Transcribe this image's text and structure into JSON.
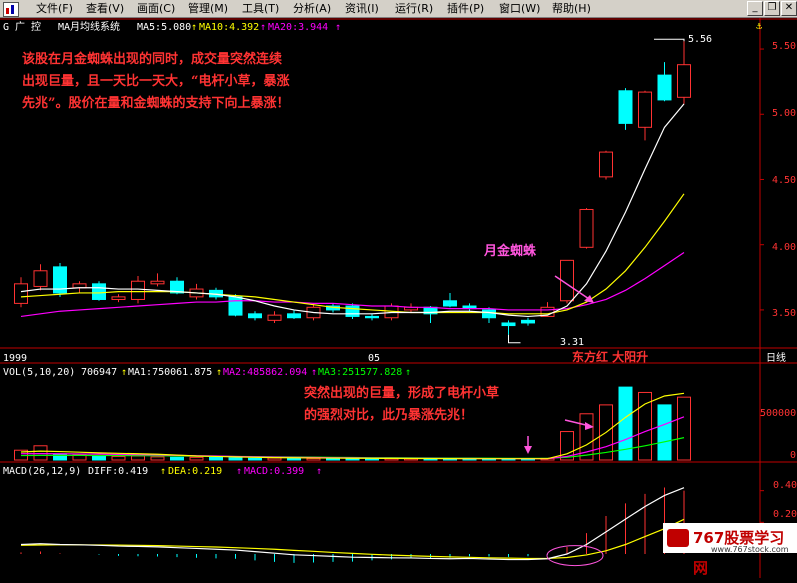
{
  "menu": [
    "文件(F)",
    "查看(V)",
    "画面(C)",
    "管理(M)",
    "工具(T)",
    "分析(A)",
    "资讯(I)",
    "运行(R)",
    "插件(P)",
    "窗口(W)",
    "帮助(H)"
  ],
  "window_controls": [
    "_",
    "❐",
    "✕"
  ],
  "header": {
    "code": "G 广  控",
    "system": "MA月均线系统",
    "ma5": "MA5:5.080",
    "ma10": "MA10:4.392",
    "ma20": "MA20:3.944",
    "arrow": "↑"
  },
  "price_axis": [
    "5.50",
    "5.00",
    "4.50",
    "4.00",
    "3.50"
  ],
  "price_labels": {
    "high": "5.56",
    "low": "3.31"
  },
  "time_axis": {
    "left": "1999",
    "mid": "05",
    "right": "日线"
  },
  "stock_name_label": "东方红  大阳升",
  "annotations": {
    "main_text": [
      "该股在月金蜘蛛出现的同时，成交量突然连续",
      "出现巨量，且一天比一天大，“电杆小草，暴涨",
      "先兆”。股价在量和金蜘蛛的支持下向上暴涨！"
    ],
    "spider": "月金蜘蛛",
    "volume_text": [
      "突然出现的巨量，形成了电杆小草",
      "的强烈对比，此乃暴涨先兆！"
    ]
  },
  "vol_header": {
    "label": "VOL(5,10,20)",
    "value": "706947",
    "ma1": "MA1:750061.875",
    "ma2": "MA2:485862.094",
    "ma3": "MA3:251577.828",
    "arrow": "↑"
  },
  "vol_axis": [
    "500000",
    "0"
  ],
  "macd_header": {
    "label": "MACD(26,12,9)",
    "diff": "DIFF:0.419",
    "dea": "DEA:0.219",
    "macd": "MACD:0.399",
    "arrow": "↑"
  },
  "macd_axis": [
    "0.40",
    "0.20"
  ],
  "logo": {
    "text": "767股票学习网",
    "sub": "www.767stock.com"
  },
  "colors": {
    "up": "#ff3232",
    "down": "#00ffff",
    "ma5": "#ffffff",
    "ma10": "#ffff00",
    "ma20": "#ff00ff",
    "ma_green": "#00ff00",
    "text_red": "#ff3333"
  },
  "chart_data": {
    "type": "candlestick",
    "price_ylim": [
      3.3,
      5.6
    ],
    "candles": [
      {
        "o": 3.55,
        "c": 3.7,
        "h": 3.75,
        "l": 3.52,
        "up": true
      },
      {
        "o": 3.68,
        "c": 3.8,
        "h": 3.85,
        "l": 3.65,
        "up": true
      },
      {
        "o": 3.83,
        "c": 3.63,
        "h": 3.86,
        "l": 3.6,
        "up": false
      },
      {
        "o": 3.67,
        "c": 3.7,
        "h": 3.72,
        "l": 3.63,
        "up": true
      },
      {
        "o": 3.7,
        "c": 3.58,
        "h": 3.72,
        "l": 3.57,
        "up": false
      },
      {
        "o": 3.58,
        "c": 3.6,
        "h": 3.62,
        "l": 3.56,
        "up": true
      },
      {
        "o": 3.58,
        "c": 3.72,
        "h": 3.76,
        "l": 3.55,
        "up": true
      },
      {
        "o": 3.7,
        "c": 3.72,
        "h": 3.78,
        "l": 3.68,
        "up": true
      },
      {
        "o": 3.72,
        "c": 3.63,
        "h": 3.75,
        "l": 3.62,
        "up": false
      },
      {
        "o": 3.6,
        "c": 3.66,
        "h": 3.7,
        "l": 3.58,
        "up": true
      },
      {
        "o": 3.65,
        "c": 3.6,
        "h": 3.67,
        "l": 3.58,
        "up": false
      },
      {
        "o": 3.6,
        "c": 3.46,
        "h": 3.62,
        "l": 3.45,
        "up": false
      },
      {
        "o": 3.47,
        "c": 3.44,
        "h": 3.49,
        "l": 3.42,
        "up": false
      },
      {
        "o": 3.42,
        "c": 3.46,
        "h": 3.49,
        "l": 3.4,
        "up": true
      },
      {
        "o": 3.47,
        "c": 3.44,
        "h": 3.5,
        "l": 3.43,
        "up": false
      },
      {
        "o": 3.44,
        "c": 3.52,
        "h": 3.55,
        "l": 3.42,
        "up": true
      },
      {
        "o": 3.53,
        "c": 3.5,
        "h": 3.55,
        "l": 3.48,
        "up": false
      },
      {
        "o": 3.53,
        "c": 3.45,
        "h": 3.55,
        "l": 3.43,
        "up": false
      },
      {
        "o": 3.45,
        "c": 3.44,
        "h": 3.47,
        "l": 3.42,
        "up": false
      },
      {
        "o": 3.44,
        "c": 3.53,
        "h": 3.55,
        "l": 3.42,
        "up": true
      },
      {
        "o": 3.5,
        "c": 3.52,
        "h": 3.55,
        "l": 3.48,
        "up": true
      },
      {
        "o": 3.52,
        "c": 3.47,
        "h": 3.53,
        "l": 3.4,
        "up": false
      },
      {
        "o": 3.57,
        "c": 3.53,
        "h": 3.63,
        "l": 3.52,
        "up": false
      },
      {
        "o": 3.53,
        "c": 3.51,
        "h": 3.55,
        "l": 3.49,
        "up": false
      },
      {
        "o": 3.5,
        "c": 3.44,
        "h": 3.52,
        "l": 3.4,
        "up": false
      },
      {
        "o": 3.4,
        "c": 3.38,
        "h": 3.42,
        "l": 3.31,
        "up": false
      },
      {
        "o": 3.4,
        "c": 3.42,
        "h": 3.44,
        "l": 3.38,
        "up": false
      },
      {
        "o": 3.45,
        "c": 3.52,
        "h": 3.56,
        "l": 3.45,
        "up": true
      },
      {
        "o": 3.57,
        "c": 3.88,
        "h": 3.88,
        "l": 3.55,
        "up": true
      },
      {
        "o": 3.98,
        "c": 4.27,
        "h": 4.28,
        "l": 3.97,
        "up": true
      },
      {
        "o": 4.52,
        "c": 4.71,
        "h": 4.72,
        "l": 4.5,
        "up": true
      },
      {
        "o": 4.93,
        "c": 5.18,
        "h": 5.2,
        "l": 4.88,
        "up": false
      },
      {
        "o": 4.9,
        "c": 5.17,
        "h": 5.18,
        "l": 4.8,
        "up": true
      },
      {
        "o": 5.11,
        "c": 5.3,
        "h": 5.4,
        "l": 5.1,
        "up": false
      },
      {
        "o": 5.13,
        "c": 5.38,
        "h": 5.56,
        "l": 5.08,
        "up": true
      }
    ],
    "ma5": [
      3.64,
      3.66,
      3.66,
      3.67,
      3.67,
      3.66,
      3.66,
      3.65,
      3.64,
      3.63,
      3.62,
      3.6,
      3.57,
      3.53,
      3.5,
      3.48,
      3.47,
      3.47,
      3.47,
      3.48,
      3.48,
      3.48,
      3.49,
      3.49,
      3.48,
      3.46,
      3.45,
      3.46,
      3.53,
      3.7,
      3.95,
      4.25,
      4.58,
      4.9,
      5.08
    ],
    "ma10": [
      3.6,
      3.61,
      3.62,
      3.63,
      3.63,
      3.64,
      3.64,
      3.64,
      3.64,
      3.63,
      3.62,
      3.61,
      3.6,
      3.58,
      3.56,
      3.54,
      3.52,
      3.51,
      3.5,
      3.49,
      3.48,
      3.48,
      3.48,
      3.48,
      3.48,
      3.47,
      3.47,
      3.47,
      3.5,
      3.56,
      3.66,
      3.8,
      3.98,
      4.18,
      4.39
    ],
    "ma20": [
      3.45,
      3.47,
      3.49,
      3.5,
      3.51,
      3.52,
      3.53,
      3.54,
      3.55,
      3.56,
      3.56,
      3.57,
      3.57,
      3.56,
      3.56,
      3.55,
      3.55,
      3.54,
      3.53,
      3.53,
      3.52,
      3.52,
      3.51,
      3.51,
      3.51,
      3.5,
      3.5,
      3.5,
      3.51,
      3.54,
      3.58,
      3.65,
      3.74,
      3.84,
      3.94
    ],
    "volume": [
      110000,
      160000,
      70000,
      60000,
      50000,
      40000,
      45000,
      35000,
      30000,
      30000,
      28000,
      25000,
      20000,
      22000,
      20000,
      18000,
      20000,
      18000,
      16000,
      15000,
      15000,
      14000,
      15000,
      14000,
      16000,
      15000,
      14000,
      18000,
      320000,
      520000,
      620000,
      820000,
      760000,
      620000,
      706947
    ],
    "vol_ma1": [
      90000,
      100000,
      95000,
      88000,
      80000,
      75000,
      70000,
      65000,
      55000,
      45000,
      40000,
      35000,
      30000,
      27000,
      25000,
      23000,
      22000,
      20000,
      19000,
      18000,
      17000,
      16000,
      15500,
      15000,
      15000,
      15000,
      15000,
      15000,
      70000,
      170000,
      310000,
      480000,
      630000,
      720000,
      750061
    ],
    "vol_ma2": [
      70000,
      72000,
      70000,
      68000,
      66000,
      63000,
      60000,
      57000,
      52000,
      48000,
      45000,
      40000,
      36000,
      33000,
      30000,
      28000,
      26000,
      24000,
      22000,
      20000,
      19000,
      18000,
      17000,
      16500,
      16000,
      16000,
      15500,
      15500,
      40000,
      90000,
      150000,
      230000,
      320000,
      400000,
      485862
    ],
    "vol_ma3": [
      50000,
      52000,
      52000,
      52000,
      51000,
      50000,
      49000,
      48000,
      46000,
      44000,
      42000,
      40000,
      38000,
      36000,
      34000,
      32000,
      30000,
      28000,
      26000,
      25000,
      24000,
      23000,
      22000,
      21000,
      20000,
      19000,
      19000,
      19000,
      30000,
      55000,
      85000,
      120000,
      160000,
      205000,
      251577
    ],
    "vol_ylim": [
      0,
      900000
    ],
    "diff": [
      0.06,
      0.065,
      0.06,
      0.058,
      0.055,
      0.05,
      0.048,
      0.045,
      0.04,
      0.035,
      0.03,
      0.025,
      0.015,
      0.005,
      -0.005,
      -0.01,
      -0.015,
      -0.02,
      -0.022,
      -0.024,
      -0.025,
      -0.028,
      -0.03,
      -0.028,
      -0.032,
      -0.035,
      -0.035,
      -0.03,
      0.0,
      0.06,
      0.14,
      0.22,
      0.3,
      0.37,
      0.419
    ],
    "dea": [
      0.055,
      0.057,
      0.058,
      0.058,
      0.057,
      0.056,
      0.055,
      0.053,
      0.05,
      0.047,
      0.044,
      0.04,
      0.035,
      0.03,
      0.023,
      0.017,
      0.01,
      0.004,
      -0.002,
      -0.007,
      -0.011,
      -0.015,
      -0.018,
      -0.021,
      -0.024,
      -0.026,
      -0.028,
      -0.028,
      -0.022,
      -0.006,
      0.02,
      0.06,
      0.11,
      0.16,
      0.219
    ],
    "macd_ylim": [
      -0.12,
      0.48
    ]
  }
}
